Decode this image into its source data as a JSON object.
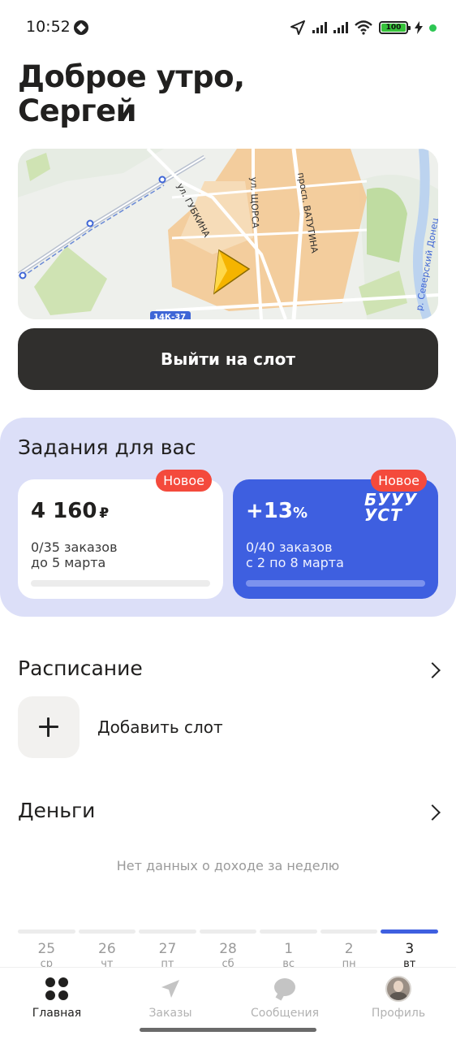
{
  "status_bar": {
    "time": "10:52",
    "battery": "100"
  },
  "greeting": {
    "line1": "Доброе утро,",
    "line2": "Сергей"
  },
  "map": {
    "streets": [
      "ул. ГУБКИНА",
      "ул. ЩОРСА",
      "просп. ВАТУТИНА",
      "р. Северский Донец"
    ],
    "road_badge": "14К-37"
  },
  "primary_button": {
    "label": "Выйти на слот"
  },
  "tasks": {
    "title": "Задания для вас",
    "cards": [
      {
        "badge": "Новое",
        "amount": "4 160",
        "currency": "₽",
        "orders": "0/35 заказов",
        "dates": "до 5 марта",
        "progress": 0
      },
      {
        "badge": "Новое",
        "amount": "+13",
        "unit": "%",
        "brand": "БУУУ УСТ",
        "orders": "0/40 заказов",
        "dates": "с 2 по 8 марта",
        "progress": 0
      }
    ]
  },
  "schedule": {
    "title": "Расписание",
    "add_slot_label": "Добавить слот"
  },
  "money": {
    "title": "Деньги",
    "empty_text": "Нет данных о доходе за неделю"
  },
  "week": {
    "days": [
      {
        "num": "25",
        "name": "ср"
      },
      {
        "num": "26",
        "name": "чт"
      },
      {
        "num": "27",
        "name": "пт"
      },
      {
        "num": "28",
        "name": "сб"
      },
      {
        "num": "1",
        "name": "вс"
      },
      {
        "num": "2",
        "name": "пн"
      },
      {
        "num": "3",
        "name": "вт"
      }
    ],
    "active_index": 6
  },
  "nav": {
    "items": [
      {
        "label": "Главная",
        "icon": "home-grid-icon"
      },
      {
        "label": "Заказы",
        "icon": "navigation-arrow-icon"
      },
      {
        "label": "Сообщения",
        "icon": "chat-bubble-icon"
      },
      {
        "label": "Профиль",
        "icon": "avatar"
      }
    ],
    "active_index": 0
  }
}
